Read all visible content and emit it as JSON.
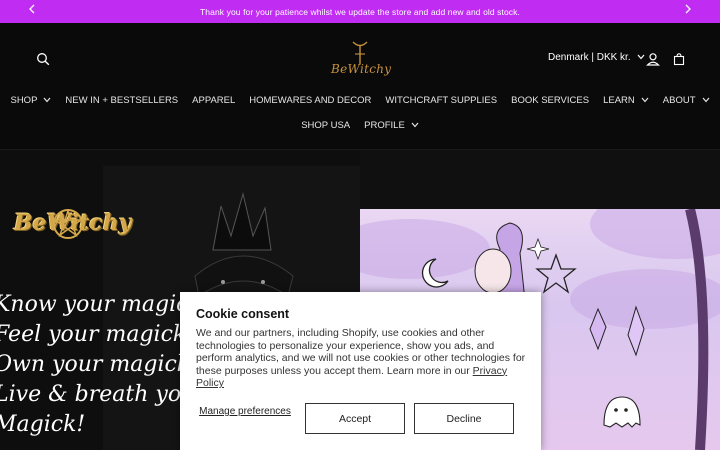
{
  "announcement": {
    "text": "Thank you for your patience whilst we update the store and add new and old stock."
  },
  "header": {
    "logo_text": "BeWitchy",
    "country_selector": "Denmark | DKK kr.",
    "nav_row1": [
      {
        "label": "SHOP",
        "has_dropdown": true
      },
      {
        "label": "NEW IN + BESTSELLERS",
        "has_dropdown": false
      },
      {
        "label": "APPAREL",
        "has_dropdown": false
      },
      {
        "label": "HOMEWARES AND DECOR",
        "has_dropdown": false
      },
      {
        "label": "WITCHCRAFT SUPPLIES",
        "has_dropdown": false
      },
      {
        "label": "BOOK SERVICES",
        "has_dropdown": false
      },
      {
        "label": "LEARN",
        "has_dropdown": true
      },
      {
        "label": "ABOUT",
        "has_dropdown": true
      }
    ],
    "nav_row2": [
      {
        "label": "SHOP USA",
        "has_dropdown": false
      },
      {
        "label": "PROFILE",
        "has_dropdown": true
      }
    ]
  },
  "hero": {
    "brand_logo": "BeWitchy",
    "tagline_lines": [
      "Know your magick,",
      "Feel your magick,",
      "Own your magick,",
      "Live & breath your",
      "Magick!"
    ]
  },
  "cookie": {
    "title": "Cookie consent",
    "body": "We and our partners, including Shopify, use cookies and other technologies to personalize your experience, show you ads, and perform analytics, and we will not use cookies or other technologies for these purposes unless you accept them. Learn more in our",
    "link": "Privacy Policy",
    "manage_label": "Manage preferences",
    "accept_label": "Accept",
    "decline_label": "Decline"
  },
  "colors": {
    "announcement_bg": "#c02cf2",
    "header_bg": "#0a0a0a",
    "logo_gold": "#c7923e",
    "art_lavender": "#e3d0f1"
  }
}
